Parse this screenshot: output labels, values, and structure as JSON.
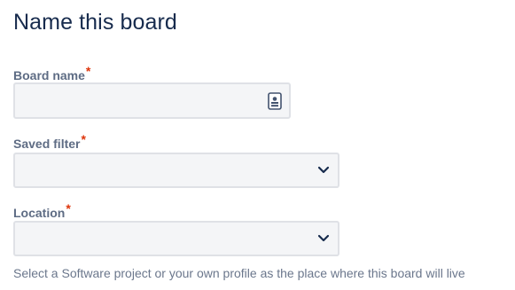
{
  "page": {
    "title": "Name this board"
  },
  "form": {
    "board_name": {
      "label": "Board name",
      "required_mark": "*",
      "value": ""
    },
    "saved_filter": {
      "label": "Saved filter",
      "required_mark": "*",
      "selected": ""
    },
    "location": {
      "label": "Location",
      "required_mark": "*",
      "selected": "",
      "helper": "Select a Software project or your own profile as the place where this board will live"
    }
  },
  "icons": {
    "input_icon": "contact-card-icon",
    "select_icon": "chevron-down-icon"
  },
  "colors": {
    "required": "#de350b",
    "field_bg": "#f4f5f7",
    "field_border": "#dfe1e6",
    "label": "#5e6c84",
    "title": "#172b4d"
  }
}
